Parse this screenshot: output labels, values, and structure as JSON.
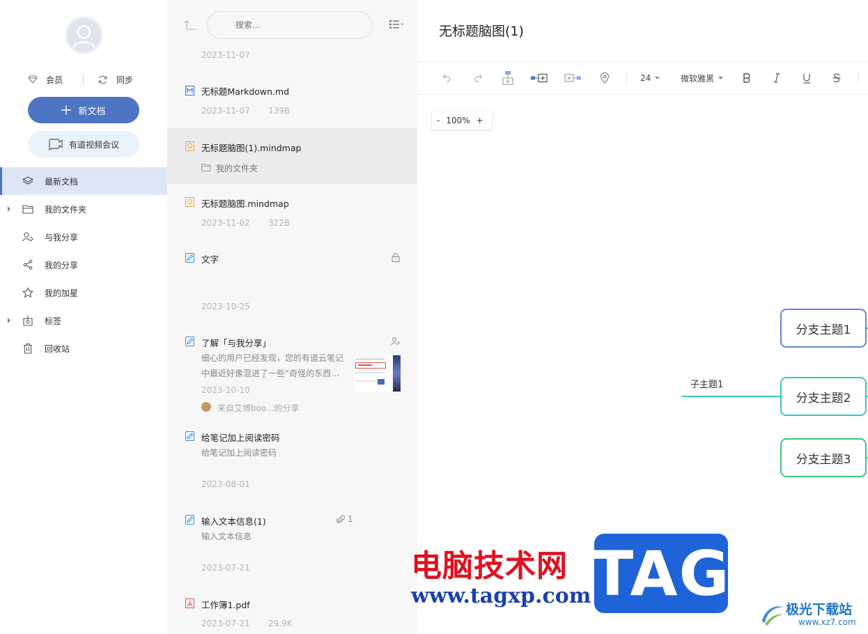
{
  "sidebar": {
    "member_label": "会员",
    "sync_label": "同步",
    "new_doc_label": "新文档",
    "meeting_label": "有道视频会议",
    "nav": [
      {
        "label": "最新文档",
        "icon": "layers-icon",
        "active": true
      },
      {
        "label": "我的文件夹",
        "icon": "folder-icon",
        "expandable": true
      },
      {
        "label": "与我分享",
        "icon": "shared-with-me-icon"
      },
      {
        "label": "我的分享",
        "icon": "share-icon"
      },
      {
        "label": "我的加星",
        "icon": "star-icon"
      },
      {
        "label": "标签",
        "icon": "tag-icon",
        "expandable": true
      },
      {
        "label": "回收站",
        "icon": "trash-icon"
      }
    ],
    "accent_color": "#4e74c4"
  },
  "list": {
    "search_placeholder": "搜索...",
    "top_date": "2023-11-07",
    "items": [
      {
        "title": "无标题Markdown.md",
        "date": "2023-11-07",
        "size": "139B",
        "icon": "markdown-icon"
      },
      {
        "title": "无标题脑图(1).mindmap",
        "folder": "我的文件夹",
        "icon": "mindmap-icon",
        "selected": true
      },
      {
        "title": "无标题脑图.mindmap",
        "date": "2023-11-02",
        "size": "322B",
        "icon": "mindmap-icon"
      },
      {
        "title": "文字",
        "date": "2023-10-25",
        "icon": "note-icon",
        "badge": "lock-icon"
      },
      {
        "title": "了解「与我分享」",
        "snippet1": "细心的用户已经发现，您的有道云笔记",
        "snippet2": "中最近好像混进了一些“奇怪的东西…",
        "date": "2023-10-10",
        "from": "来自艾博boo...的分享",
        "icon": "note-icon",
        "badge": "shared-user-icon"
      },
      {
        "title": "给笔记加上阅读密码",
        "snippet1": "给笔记加上阅读密码",
        "date": "2023-08-01",
        "icon": "note-icon"
      },
      {
        "title": "输入文本信息(1)",
        "snippet1": "输入文本信息",
        "date": "2023-07-21",
        "attach_count": "1",
        "icon": "note-icon"
      },
      {
        "title": "工作簿1.pdf",
        "date": "2023-07-21",
        "size": "29.9K",
        "icon": "pdf-icon"
      }
    ]
  },
  "editor": {
    "title": "无标题脑图(1)",
    "font_size": "24",
    "font_family": "微软雅黑",
    "zoom_minus": "-",
    "zoom_value": "100%",
    "zoom_plus": "+",
    "mindmap": {
      "branches": [
        {
          "label": "分支主题1",
          "color": "#5b86d3"
        },
        {
          "label": "分支主题2",
          "color": "#3cc4bd"
        },
        {
          "label": "分支主题3",
          "color": "#3bc77d"
        }
      ],
      "subtopic": "子主题1"
    }
  },
  "watermark": {
    "site_cn": "电脑技术网",
    "site_url": "www.tagxp.com",
    "tag": "TAG",
    "logo_cn": "极光下载站",
    "logo_url": "www.xz7.com"
  }
}
